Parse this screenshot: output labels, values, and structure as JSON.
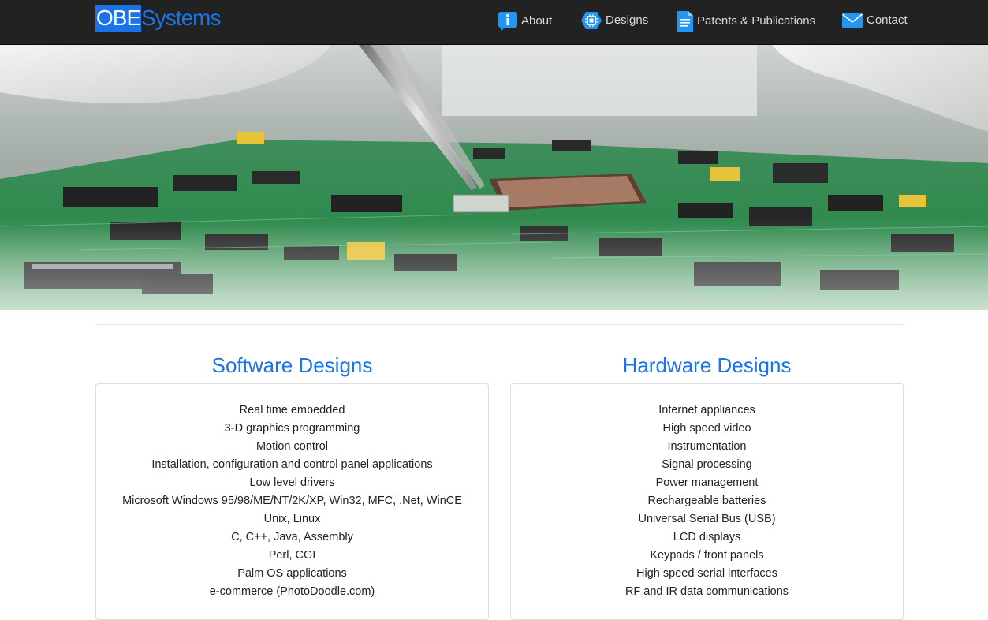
{
  "navbar": {
    "brand_part1": "OBE",
    "brand_part2": "Systems",
    "links": [
      {
        "label": "About",
        "icon": "info-icon"
      },
      {
        "label": "Designs",
        "icon": "chip-icon"
      },
      {
        "label": "Patents & Publications",
        "icon": "document-icon"
      },
      {
        "label": "Contact",
        "icon": "envelope-icon"
      }
    ]
  },
  "hero": {
    "image": "circuit-board-photo"
  },
  "software": {
    "title": "Software Designs",
    "items": [
      "Real time embedded",
      "3-D graphics programming",
      "Motion control",
      "Installation, configuration and control panel applications",
      "Low level drivers",
      "Microsoft Windows 95/98/ME/NT/2K/XP, Win32, MFC, .Net, WinCE",
      "Unix, Linux",
      "C, C++, Java, Assembly",
      "Perl, CGI",
      "Palm OS applications",
      "e-commerce (PhotoDoodle.com)"
    ]
  },
  "hardware": {
    "title": "Hardware Designs",
    "items": [
      "Internet appliances",
      "High speed video",
      "Instrumentation",
      "Signal processing",
      "Power management",
      "Rechargeable batteries",
      "Universal Serial Bus (USB)",
      "LCD displays",
      "Keypads / front panels",
      "High speed serial interfaces",
      "RF and IR data communications"
    ]
  },
  "colors": {
    "accent": "#1a73e8",
    "navbar": "#222222",
    "nav_text": "#d9d9d9"
  }
}
